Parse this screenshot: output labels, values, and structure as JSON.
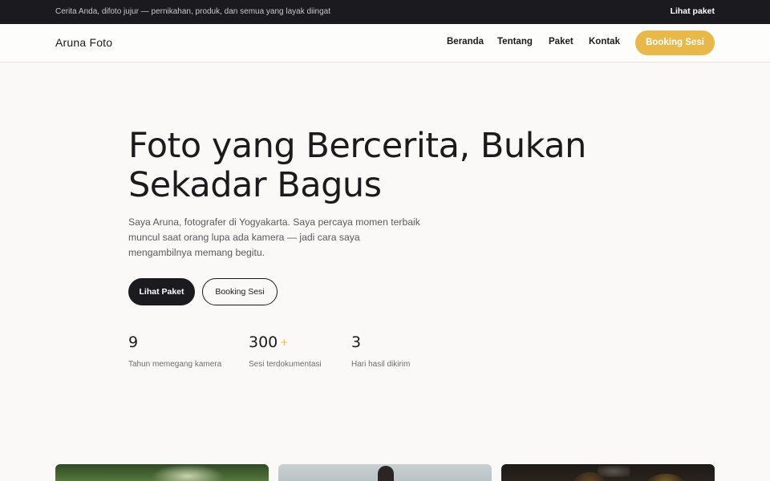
{
  "topbar": {
    "message": "Cerita Anda, difoto jujur — pernikahan, produk, dan semua yang layak diingat",
    "link_label": "Lihat paket"
  },
  "header": {
    "brand": "Aruna Foto",
    "nav": [
      "Beranda",
      "Tentang",
      "Paket",
      "Kontak"
    ],
    "cta_label": "Booking Sesi"
  },
  "hero": {
    "title_line1": "Foto yang Bercerita, Bukan",
    "title_line2": "Sekadar Bagus",
    "description": "Saya Aruna, fotografer di Yogyakarta. Saya percaya momen terbaik muncul saat orang lupa ada kamera — jadi cara saya mengambilnya memang begitu.",
    "primary_button": "Lihat Paket",
    "secondary_button": "Booking Sesi"
  },
  "stats": [
    {
      "value": "9",
      "suffix": "",
      "label": "Tahun memegang kamera"
    },
    {
      "value": "300",
      "suffix": "+",
      "label": "Sesi terdokumentasi"
    },
    {
      "value": "3",
      "suffix": "",
      "label": "Hari hasil dikirim"
    }
  ],
  "colors": {
    "accent": "#e8b94a",
    "dark": "#1b1b1f",
    "background": "#faf9f7"
  }
}
